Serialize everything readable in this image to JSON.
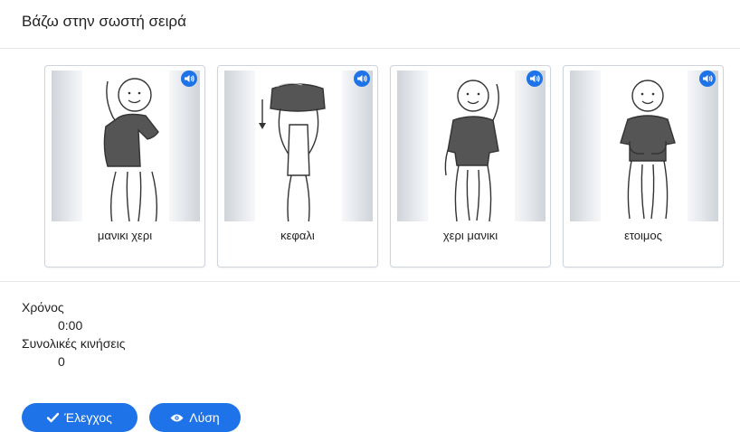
{
  "header": {
    "title": "Βάζω στην σωστή σειρά"
  },
  "cards": [
    {
      "label": "μανικι χερι",
      "icon": "sound-icon",
      "step": "one-sleeve"
    },
    {
      "label": "κεφαλι",
      "icon": "sound-icon",
      "step": "head"
    },
    {
      "label": "χερι μανικι",
      "icon": "sound-icon",
      "step": "other-sleeve"
    },
    {
      "label": "ετοιμος",
      "icon": "sound-icon",
      "step": "done"
    }
  ],
  "stats": {
    "time_label": "Χρόνος",
    "time_value": "0:00",
    "moves_label": "Συνολικές κινήσεις",
    "moves_value": "0"
  },
  "buttons": {
    "check_label": "Έλεγχος",
    "check_icon": "checkmark-icon",
    "solve_label": "Λύση",
    "solve_icon": "eye-icon"
  },
  "colors": {
    "accent": "#1e73e8",
    "shirt": "#555555",
    "panel": "#dfe3e8"
  }
}
